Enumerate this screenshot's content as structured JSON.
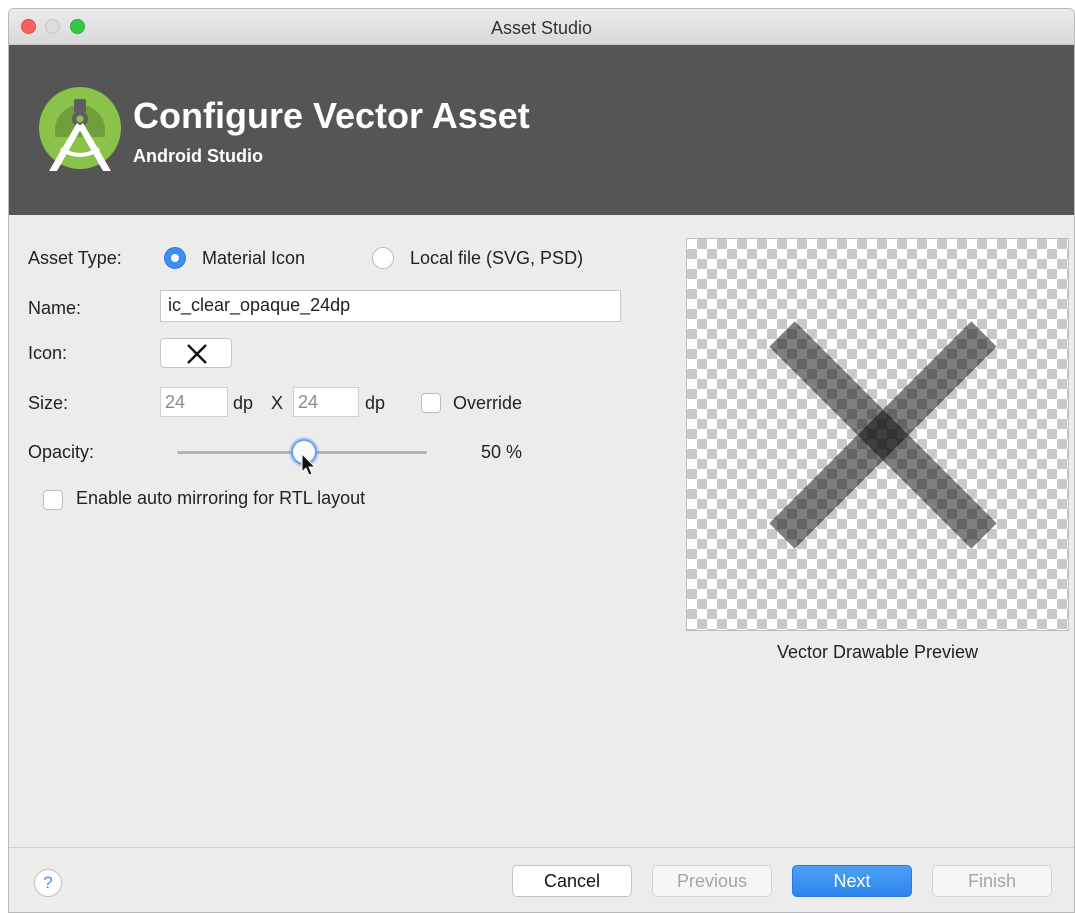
{
  "window": {
    "title": "Asset Studio"
  },
  "header": {
    "title": "Configure Vector Asset",
    "subtitle": "Android Studio"
  },
  "form": {
    "asset_type": {
      "label": "Asset Type:",
      "options": [
        {
          "label": "Material Icon",
          "selected": true
        },
        {
          "label": "Local file (SVG, PSD)",
          "selected": false
        }
      ]
    },
    "name": {
      "label": "Name:",
      "value": "ic_clear_opaque_24dp"
    },
    "icon": {
      "label": "Icon:",
      "value": "clear-icon"
    },
    "size": {
      "label": "Size:",
      "width": "24",
      "height": "24",
      "unit1": "dp",
      "separator": "X",
      "unit2": "dp",
      "override_label": "Override",
      "override_checked": false
    },
    "opacity": {
      "label": "Opacity:",
      "value_text": "50 %",
      "value": 50
    },
    "auto_mirror": {
      "label": "Enable auto mirroring for RTL layout",
      "checked": false
    }
  },
  "preview": {
    "label": "Vector Drawable Preview",
    "icon": "clear-icon",
    "opacity": 0.5
  },
  "footer": {
    "help": "?",
    "buttons": {
      "cancel": "Cancel",
      "previous": "Previous",
      "next": "Next",
      "finish": "Finish"
    }
  },
  "colors": {
    "header_bg": "#555555",
    "accent": "#3d8ef0",
    "logo_green": "#8bc34a"
  }
}
